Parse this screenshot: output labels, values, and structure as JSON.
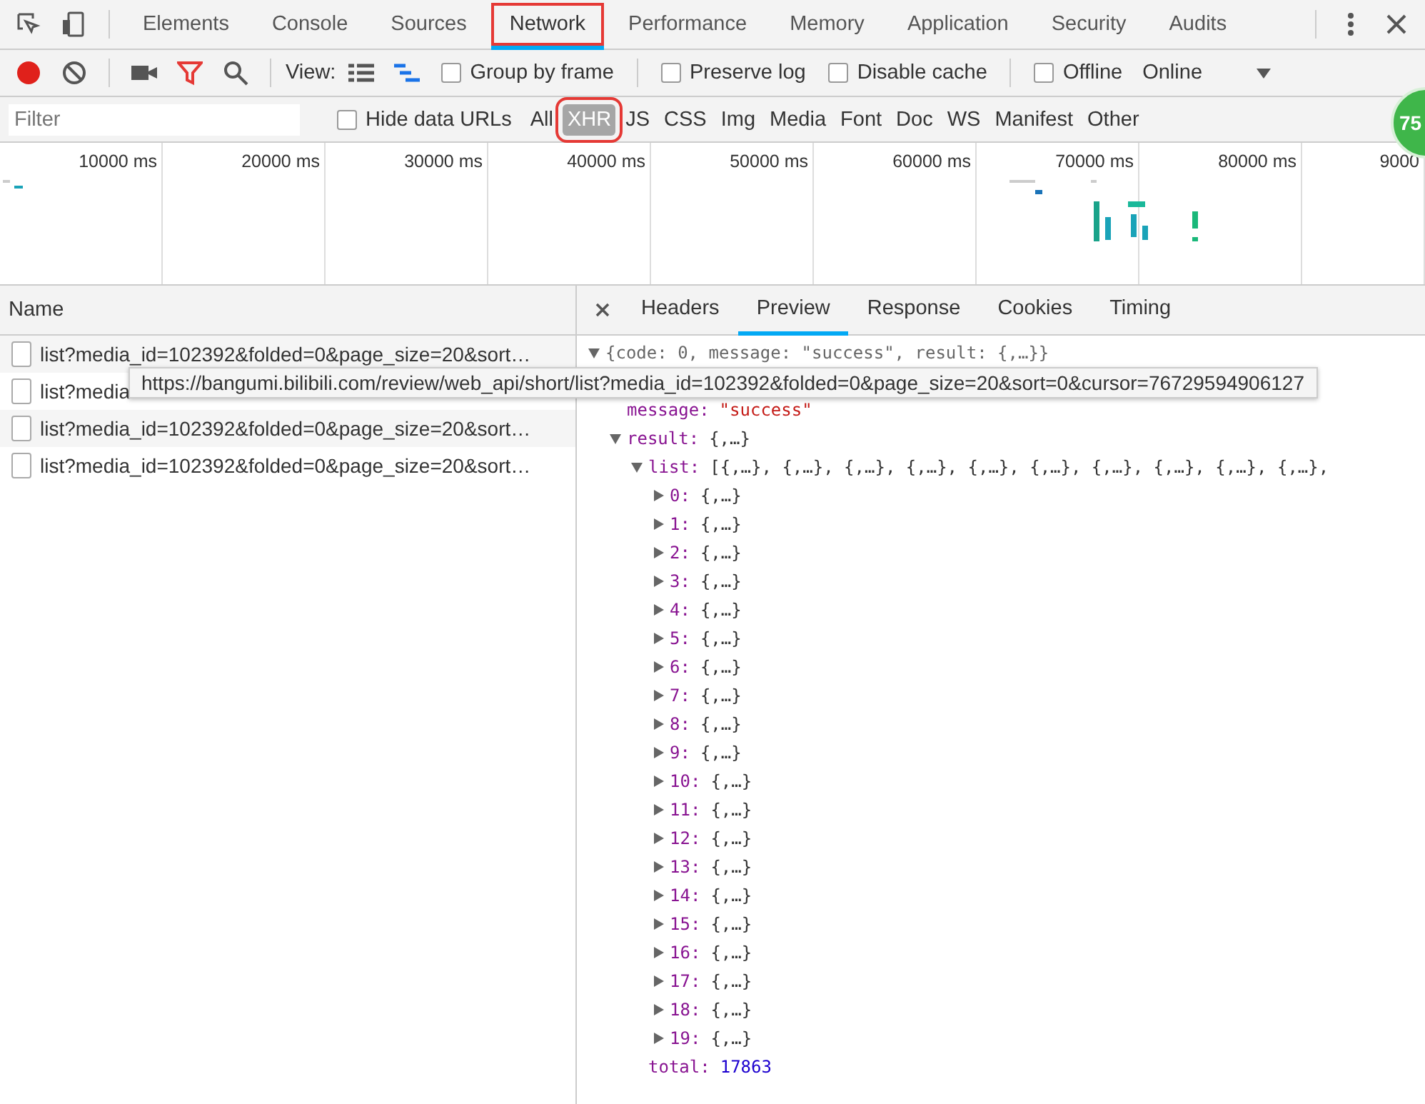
{
  "main_tabs": [
    {
      "label": "Elements",
      "selected": false,
      "highlighted": false
    },
    {
      "label": "Console",
      "selected": false,
      "highlighted": false
    },
    {
      "label": "Sources",
      "selected": false,
      "highlighted": false
    },
    {
      "label": "Network",
      "selected": true,
      "highlighted": true
    },
    {
      "label": "Performance",
      "selected": false,
      "highlighted": false
    },
    {
      "label": "Memory",
      "selected": false,
      "highlighted": false
    },
    {
      "label": "Application",
      "selected": false,
      "highlighted": false
    },
    {
      "label": "Security",
      "selected": false,
      "highlighted": false
    },
    {
      "label": "Audits",
      "selected": false,
      "highlighted": false
    }
  ],
  "toolbar": {
    "recording": true,
    "view_label": "View:",
    "checkboxes": [
      {
        "label": "Group by frame",
        "checked": false
      },
      {
        "label": "Preserve log",
        "checked": false
      },
      {
        "label": "Disable cache",
        "checked": false
      },
      {
        "label": "Offline",
        "checked": false
      }
    ],
    "throttling": "Online",
    "badge": "75"
  },
  "filter": {
    "placeholder": "Filter",
    "hide_data_urls": {
      "label": "Hide data URLs",
      "checked": false
    },
    "types": [
      {
        "label": "All",
        "selected": false,
        "highlighted": false
      },
      {
        "label": "XHR",
        "selected": true,
        "highlighted": true
      },
      {
        "label": "JS",
        "selected": false,
        "highlighted": false
      },
      {
        "label": "CSS",
        "selected": false,
        "highlighted": false
      },
      {
        "label": "Img",
        "selected": false,
        "highlighted": false
      },
      {
        "label": "Media",
        "selected": false,
        "highlighted": false
      },
      {
        "label": "Font",
        "selected": false,
        "highlighted": false
      },
      {
        "label": "Doc",
        "selected": false,
        "highlighted": false
      },
      {
        "label": "WS",
        "selected": false,
        "highlighted": false
      },
      {
        "label": "Manifest",
        "selected": false,
        "highlighted": false
      },
      {
        "label": "Other",
        "selected": false,
        "highlighted": false
      }
    ]
  },
  "timeline": {
    "ticks": [
      "10000 ms",
      "20000 ms",
      "30000 ms",
      "40000 ms",
      "50000 ms",
      "60000 ms",
      "70000 ms",
      "80000 ms",
      "9000"
    ]
  },
  "requests": {
    "column": "Name",
    "rows": [
      {
        "name": "list?media_id=102392&folded=0&page_size=20&sort…"
      },
      {
        "name": "list?media"
      },
      {
        "name": "list?media_id=102392&folded=0&page_size=20&sort…"
      },
      {
        "name": "list?media_id=102392&folded=0&page_size=20&sort…"
      }
    ]
  },
  "tooltip": "https://bangumi.bilibili.com/review/web_api/short/list?media_id=102392&folded=0&page_size=20&sort=0&cursor=76729594906127",
  "detail_tabs": [
    {
      "label": "Headers",
      "selected": false
    },
    {
      "label": "Preview",
      "selected": true
    },
    {
      "label": "Response",
      "selected": false
    },
    {
      "label": "Cookies",
      "selected": false
    },
    {
      "label": "Timing",
      "selected": false
    }
  ],
  "preview": {
    "summary": "{code: 0, message: \"success\", result: {,…}}",
    "expanded": true,
    "children": [
      {
        "key": "message:",
        "value": "\"success\"",
        "color": "#c41a16"
      },
      {
        "key": "result:",
        "value": "{,…}",
        "color": "#333333",
        "expanded": true,
        "children": [
          {
            "key": "list:",
            "value": "[{,…}, {,…}, {,…}, {,…}, {,…}, {,…}, {,…}, {,…}, {,…}, {,…},",
            "color": "#333333",
            "expanded": true,
            "children": [
              {
                "key": "0:",
                "value": "{,…}",
                "color": "#333333",
                "expanded": false
              },
              {
                "key": "1:",
                "value": "{,…}",
                "color": "#333333",
                "expanded": false
              },
              {
                "key": "2:",
                "value": "{,…}",
                "color": "#333333",
                "expanded": false
              },
              {
                "key": "3:",
                "value": "{,…}",
                "color": "#333333",
                "expanded": false
              },
              {
                "key": "4:",
                "value": "{,…}",
                "color": "#333333",
                "expanded": false
              },
              {
                "key": "5:",
                "value": "{,…}",
                "color": "#333333",
                "expanded": false
              },
              {
                "key": "6:",
                "value": "{,…}",
                "color": "#333333",
                "expanded": false
              },
              {
                "key": "7:",
                "value": "{,…}",
                "color": "#333333",
                "expanded": false
              },
              {
                "key": "8:",
                "value": "{,…}",
                "color": "#333333",
                "expanded": false
              },
              {
                "key": "9:",
                "value": "{,…}",
                "color": "#333333",
                "expanded": false
              },
              {
                "key": "10:",
                "value": "{,…}",
                "color": "#333333",
                "expanded": false
              },
              {
                "key": "11:",
                "value": "{,…}",
                "color": "#333333",
                "expanded": false
              },
              {
                "key": "12:",
                "value": "{,…}",
                "color": "#333333",
                "expanded": false
              },
              {
                "key": "13:",
                "value": "{,…}",
                "color": "#333333",
                "expanded": false
              },
              {
                "key": "14:",
                "value": "{,…}",
                "color": "#333333",
                "expanded": false
              },
              {
                "key": "15:",
                "value": "{,…}",
                "color": "#333333",
                "expanded": false
              },
              {
                "key": "16:",
                "value": "{,…}",
                "color": "#333333",
                "expanded": false
              },
              {
                "key": "17:",
                "value": "{,…}",
                "color": "#333333",
                "expanded": false
              },
              {
                "key": "18:",
                "value": "{,…}",
                "color": "#333333",
                "expanded": false
              },
              {
                "key": "19:",
                "value": "{,…}",
                "color": "#333333",
                "expanded": false
              }
            ]
          },
          {
            "key": "total:",
            "value": "17863",
            "color": "#1c00cf"
          }
        ]
      }
    ]
  }
}
